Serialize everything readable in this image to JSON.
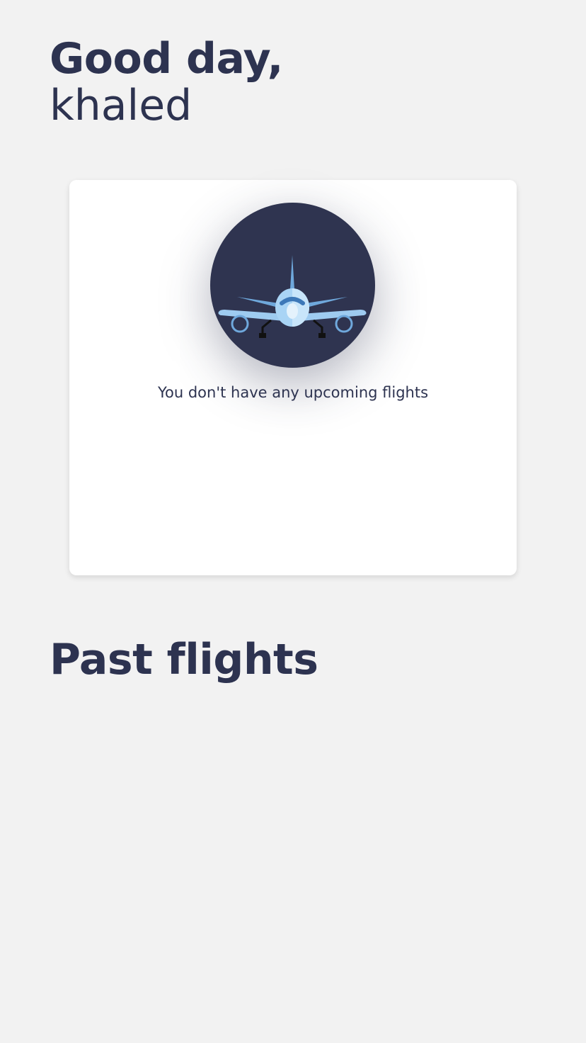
{
  "greeting": {
    "line1": "Good day,",
    "name": "khaled"
  },
  "upcoming": {
    "icon": "airplane-icon",
    "empty_message": "You don't have any upcoming flights"
  },
  "past": {
    "title": "Past flights"
  },
  "colors": {
    "background": "#f2f2f2",
    "card": "#ffffff",
    "text": "#2d3350",
    "circle": "#2f3450",
    "plane": "#9ecbf0"
  }
}
